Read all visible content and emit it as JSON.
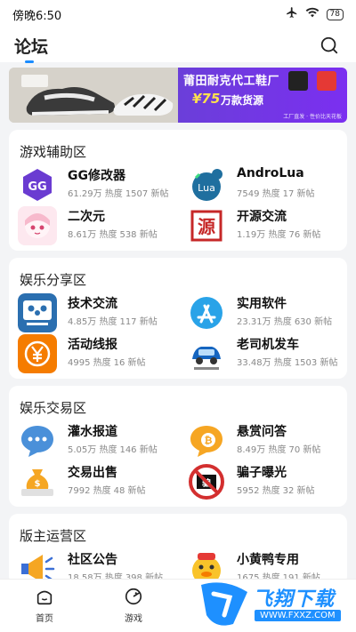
{
  "status_bar": {
    "time": "傍晚6:50",
    "battery": "78"
  },
  "header": {
    "title": "论坛"
  },
  "banner": {
    "headline": "莆田耐克代工鞋厂",
    "price": "¥75",
    "sub": "万款货源",
    "foot": "工厂直发 · 性价比天花板",
    "accent_color": "#7b2ff0"
  },
  "sections": [
    {
      "title": "游戏辅助区",
      "items": [
        {
          "name": "GG修改器",
          "heat": "61.29万 热度",
          "posts": "1507 新帖",
          "icon": "gg-modifier-icon"
        },
        {
          "name": "AndroLua",
          "heat": "7549 热度",
          "posts": "17 新帖",
          "icon": "androlua-icon"
        },
        {
          "name": "二次元",
          "heat": "8.61万 热度",
          "posts": "538 新帖",
          "icon": "anime-girl-icon"
        },
        {
          "name": "开源交流",
          "heat": "1.19万 热度",
          "posts": "76 新帖",
          "icon": "open-source-icon"
        }
      ]
    },
    {
      "title": "娱乐分享区",
      "items": [
        {
          "name": "技术交流",
          "heat": "4.85万 热度",
          "posts": "117 新帖",
          "icon": "tech-exchange-icon"
        },
        {
          "name": "实用软件",
          "heat": "23.31万 热度",
          "posts": "630 新帖",
          "icon": "app-store-icon"
        },
        {
          "name": "活动线报",
          "heat": "4995 热度",
          "posts": "16 新帖",
          "icon": "yen-coin-icon"
        },
        {
          "name": "老司机发车",
          "heat": "33.48万 热度",
          "posts": "1503 新帖",
          "icon": "car-icon"
        }
      ]
    },
    {
      "title": "娱乐交易区",
      "items": [
        {
          "name": "灌水报道",
          "heat": "5.05万 热度",
          "posts": "146 新帖",
          "icon": "chat-bubble-icon"
        },
        {
          "name": "悬赏问答",
          "heat": "8.49万 热度",
          "posts": "70 新帖",
          "icon": "bitcoin-bubble-icon"
        },
        {
          "name": "交易出售",
          "heat": "7992 热度",
          "posts": "48 新帖",
          "icon": "money-bag-icon"
        },
        {
          "name": "骗子曝光",
          "heat": "5952 热度",
          "posts": "32 新帖",
          "icon": "no-scam-icon"
        }
      ]
    },
    {
      "title": "版主运营区",
      "items": [
        {
          "name": "社区公告",
          "heat": "18.58万 热度",
          "posts": "398 新帖",
          "icon": "megaphone-icon"
        },
        {
          "name": "小黄鸭专用",
          "heat": "1675 热度",
          "posts": "191 新帖",
          "icon": "yellow-duck-icon"
        }
      ]
    }
  ],
  "bottom_nav": [
    {
      "label": "首页",
      "icon": "home-icon"
    },
    {
      "label": "游戏",
      "icon": "game-icon"
    }
  ],
  "watermark": {
    "title": "飞翔下载",
    "url": "WWW.FXXZ.COM"
  }
}
